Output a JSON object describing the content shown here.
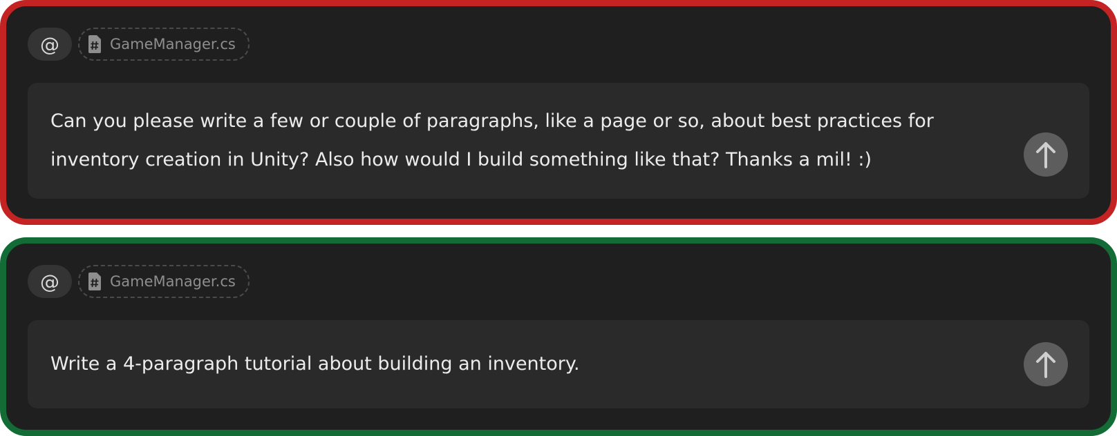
{
  "panels": [
    {
      "id": "verbose-prompt",
      "border_color": "#c42323",
      "mention_icon": "at-sign-icon",
      "file_chip": {
        "icon": "csharp-file-icon",
        "label": "GameManager.cs"
      },
      "prompt": "Can you please write a few or couple of paragraphs, like a page or so, about best practices for inventory creation in Unity? Also how would I build something like that? Thanks a mil! :)",
      "send_icon": "arrow-up-icon"
    },
    {
      "id": "concise-prompt",
      "border_color": "#136c36",
      "mention_icon": "at-sign-icon",
      "file_chip": {
        "icon": "csharp-file-icon",
        "label": "GameManager.cs"
      },
      "prompt": "Write a 4-paragraph tutorial about building an inventory.",
      "send_icon": "arrow-up-icon"
    }
  ],
  "colors": {
    "panel_background": "#1f1f1f",
    "input_background": "#2a2a2a",
    "send_button": "#5d5d5d"
  }
}
